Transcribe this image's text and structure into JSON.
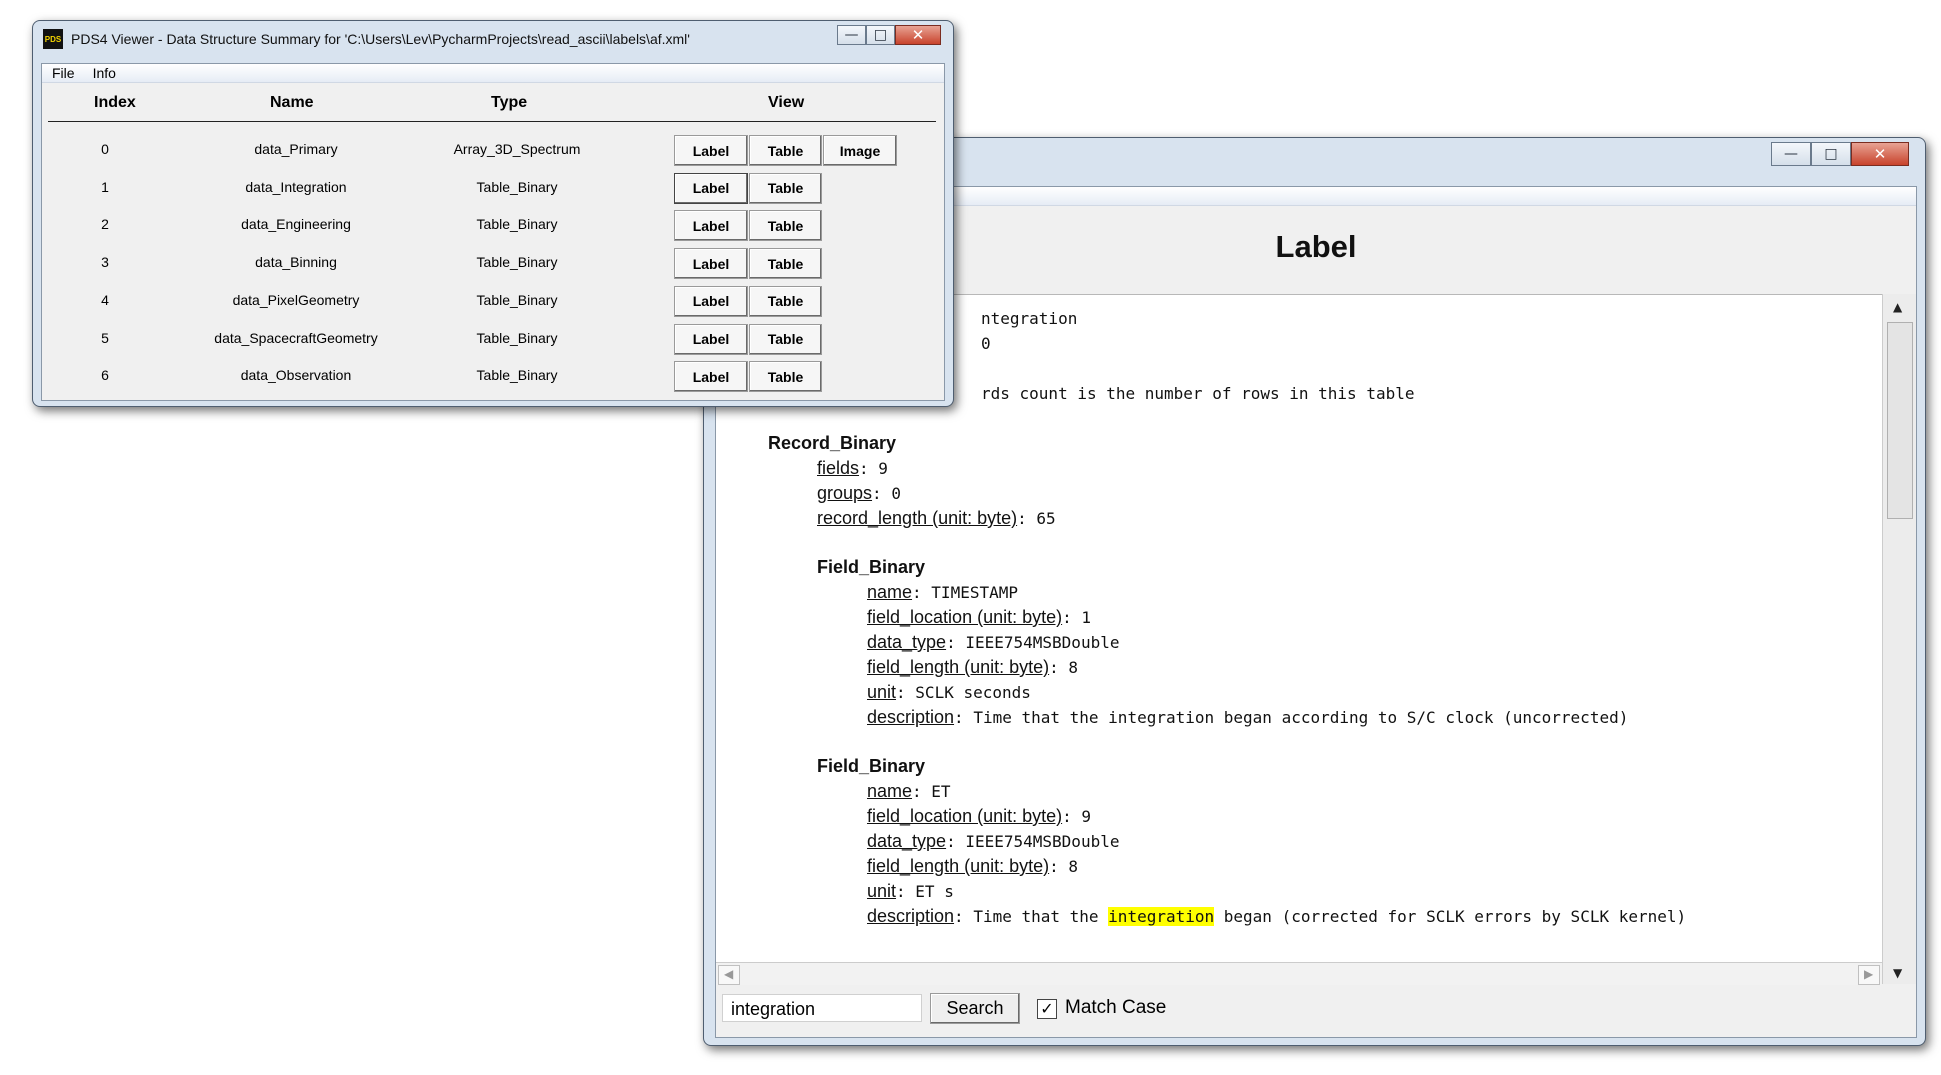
{
  "summary_window": {
    "title": "PDS4 Viewer - Data Structure Summary for 'C:\\Users\\Lev\\PycharmProjects\\read_ascii\\labels\\af.xml'",
    "app_icon": "PDS",
    "menu": [
      "File",
      "Info"
    ],
    "columns": [
      "Index",
      "Name",
      "Type",
      "View"
    ],
    "rows": [
      {
        "index": "0",
        "name": "data_Primary",
        "type": "Array_3D_Spectrum",
        "buttons": [
          "Label",
          "Table",
          "Image"
        ]
      },
      {
        "index": "1",
        "name": "data_Integration",
        "type": "Table_Binary",
        "buttons": [
          "Label",
          "Table"
        ]
      },
      {
        "index": "2",
        "name": "data_Engineering",
        "type": "Table_Binary",
        "buttons": [
          "Label",
          "Table"
        ]
      },
      {
        "index": "3",
        "name": "data_Binning",
        "type": "Table_Binary",
        "buttons": [
          "Label",
          "Table"
        ]
      },
      {
        "index": "4",
        "name": "data_PixelGeometry",
        "type": "Table_Binary",
        "buttons": [
          "Label",
          "Table"
        ]
      },
      {
        "index": "5",
        "name": "data_SpacecraftGeometry",
        "type": "Table_Binary",
        "buttons": [
          "Label",
          "Table"
        ]
      },
      {
        "index": "6",
        "name": "data_Observation",
        "type": "Table_Binary",
        "buttons": [
          "Label",
          "Table"
        ]
      }
    ]
  },
  "label_window": {
    "heading": "Label",
    "partial_lines": [
      "ntegration",
      "0",
      "rds count is the number of rows in this table"
    ],
    "record": {
      "section": "Record_Binary",
      "fields_key": "fields",
      "fields_val": ": 9",
      "groups_key": "groups",
      "groups_val": ": 0",
      "reclen_key": "record_length (unit: byte)",
      "reclen_val": ": 65"
    },
    "field1": {
      "section": "Field_Binary",
      "name_key": "name",
      "name_val": ": TIMESTAMP",
      "loc_key": "field_location (unit: byte)",
      "loc_val": ": 1",
      "dtype_key": "data_type",
      "dtype_val": ": IEEE754MSBDouble",
      "len_key": "field_length (unit: byte)",
      "len_val": ": 8",
      "unit_key": "unit",
      "unit_val": ": SCLK seconds",
      "desc_key": "description",
      "desc_val": ": Time that the integration began according to S/C clock (uncorrected)"
    },
    "field2": {
      "section": "Field_Binary",
      "name_key": "name",
      "name_val": ": ET",
      "loc_key": "field_location (unit: byte)",
      "loc_val": ": 9",
      "dtype_key": "data_type",
      "dtype_val": ": IEEE754MSBDouble",
      "len_key": "field_length (unit: byte)",
      "len_val": ": 8",
      "unit_key": "unit",
      "unit_val": ": ET s",
      "desc_key": "description",
      "desc_pre": ": Time that the ",
      "desc_hl": "integration",
      "desc_post": " began (corrected for SCLK errors by SCLK kernel)"
    },
    "search": {
      "value": "integration",
      "button": "Search",
      "match_case_label": "Match Case",
      "match_case_checked": true
    }
  },
  "colors": {
    "highlight": "#ffff00",
    "window_frame": "#d8e3ef",
    "close_button": "#c8432c"
  }
}
